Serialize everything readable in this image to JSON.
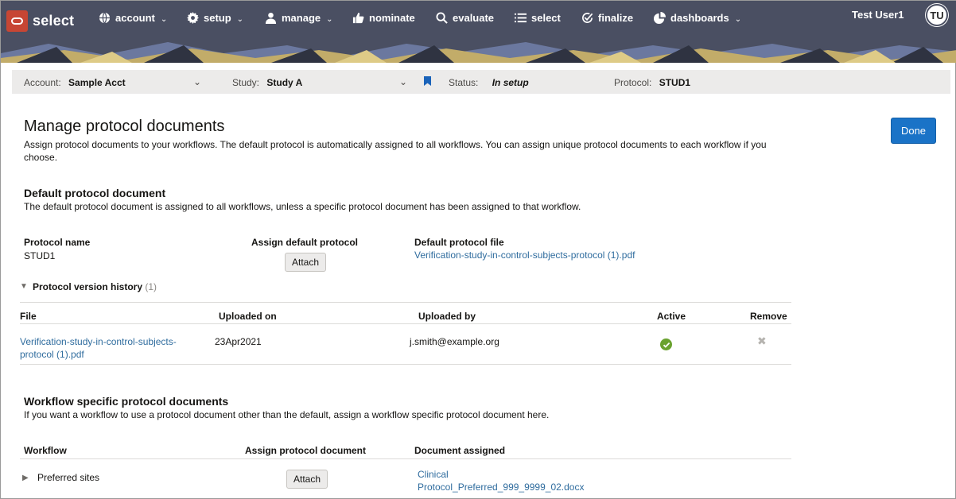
{
  "nav": {
    "brand": "select",
    "items": [
      {
        "label": "account",
        "icon": "globe-icon",
        "dropdown": true
      },
      {
        "label": "setup",
        "icon": "gear-icon",
        "dropdown": true
      },
      {
        "label": "manage",
        "icon": "person-icon",
        "dropdown": true
      },
      {
        "label": "nominate",
        "icon": "thumbs-up-icon",
        "dropdown": false
      },
      {
        "label": "evaluate",
        "icon": "search-icon",
        "dropdown": false
      },
      {
        "label": "select",
        "icon": "list-icon",
        "dropdown": false
      },
      {
        "label": "finalize",
        "icon": "check-circle-icon",
        "dropdown": false
      },
      {
        "label": "dashboards",
        "icon": "pie-chart-icon",
        "dropdown": true
      }
    ],
    "user_name": "Test User1",
    "user_initials": "TU"
  },
  "context": {
    "account_label": "Account:",
    "account_value": "Sample Acct",
    "study_label": "Study:",
    "study_value": "Study A",
    "status_label": "Status:",
    "status_value": "In setup",
    "protocol_label": "Protocol:",
    "protocol_value": "STUD1"
  },
  "page": {
    "title": "Manage protocol documents",
    "intro": "Assign protocol documents to your workflows. The default protocol is automatically assigned to all workflows. You can assign unique protocol documents to each workflow if you choose.",
    "done_label": "Done"
  },
  "default_section": {
    "title": "Default protocol document",
    "description": "The default protocol document is assigned to all workflows, unless a specific protocol document has been assigned to that workflow.",
    "col_protocol_name": "Protocol name",
    "col_assign": "Assign default protocol",
    "col_file": "Default protocol file",
    "protocol_name": "STUD1",
    "attach_label": "Attach",
    "default_file": "Verification-study-in-control-subjects-protocol (1).pdf"
  },
  "history": {
    "label": "Protocol version history",
    "count": "(1)",
    "columns": [
      "File",
      "Uploaded on",
      "Uploaded by",
      "Active",
      "Remove"
    ],
    "rows": [
      {
        "file_line1": "Verification-study-in-control-subjects-",
        "file_line2": "protocol (1).pdf",
        "uploaded_on": "23Apr2021",
        "uploaded_by": "j.smith@example.org",
        "active": true
      }
    ]
  },
  "workflow_section": {
    "title": "Workflow specific protocol documents",
    "description": "If you want a workflow to use a protocol document other than the default, assign a workflow specific protocol document here.",
    "columns": [
      "Workflow",
      "Assign protocol document",
      "Document assigned"
    ],
    "rows": [
      {
        "workflow": "Preferred sites",
        "attach_label": "Attach",
        "doc_line1": "Clinical",
        "doc_line2": "Protocol_Preferred_999_9999_02.docx"
      }
    ]
  },
  "colors": {
    "nav_bg": "#4a4f62",
    "brand_red": "#c74634",
    "primary_button": "#1a73c7",
    "link": "#2f6c9e",
    "success": "#6aa22f"
  }
}
